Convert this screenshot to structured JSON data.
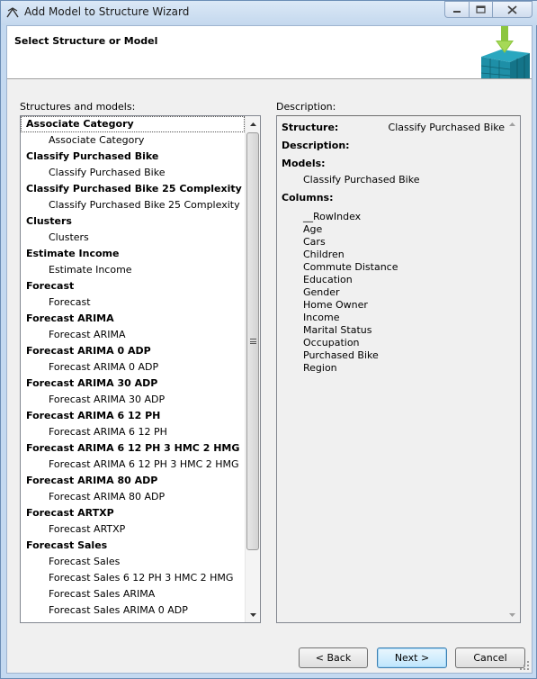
{
  "window": {
    "title": "Add Model to Structure Wizard"
  },
  "header": {
    "title": "Select Structure or Model"
  },
  "left_label": "Structures and models:",
  "right_label": "Description:",
  "list": [
    {
      "text": "Associate Category",
      "kind": "struct"
    },
    {
      "text": "Associate Category",
      "kind": "model"
    },
    {
      "text": "Classify Purchased Bike",
      "kind": "struct"
    },
    {
      "text": "Classify Purchased Bike",
      "kind": "model"
    },
    {
      "text": "Classify Purchased Bike 25 Complexity",
      "kind": "struct"
    },
    {
      "text": "Classify Purchased Bike 25 Complexity",
      "kind": "model"
    },
    {
      "text": "Clusters",
      "kind": "struct"
    },
    {
      "text": "Clusters",
      "kind": "model"
    },
    {
      "text": "Estimate Income",
      "kind": "struct"
    },
    {
      "text": "Estimate Income",
      "kind": "model"
    },
    {
      "text": "Forecast",
      "kind": "struct"
    },
    {
      "text": "Forecast",
      "kind": "model"
    },
    {
      "text": "Forecast ARIMA",
      "kind": "struct"
    },
    {
      "text": "Forecast ARIMA",
      "kind": "model"
    },
    {
      "text": "Forecast ARIMA 0 ADP",
      "kind": "struct"
    },
    {
      "text": "Forecast ARIMA 0 ADP",
      "kind": "model"
    },
    {
      "text": "Forecast ARIMA 30 ADP",
      "kind": "struct"
    },
    {
      "text": "Forecast ARIMA 30 ADP",
      "kind": "model"
    },
    {
      "text": "Forecast ARIMA 6 12 PH",
      "kind": "struct"
    },
    {
      "text": "Forecast ARIMA 6 12 PH",
      "kind": "model"
    },
    {
      "text": "Forecast ARIMA 6 12 PH 3 HMC 2 HMG",
      "kind": "struct"
    },
    {
      "text": "Forecast ARIMA 6 12 PH 3 HMC 2 HMG",
      "kind": "model"
    },
    {
      "text": "Forecast ARIMA 80 ADP",
      "kind": "struct"
    },
    {
      "text": "Forecast ARIMA 80 ADP",
      "kind": "model"
    },
    {
      "text": "Forecast ARTXP",
      "kind": "struct"
    },
    {
      "text": "Forecast ARTXP",
      "kind": "model"
    },
    {
      "text": "Forecast Sales",
      "kind": "struct"
    },
    {
      "text": "Forecast Sales",
      "kind": "model"
    },
    {
      "text": "Forecast Sales 6 12 PH 3 HMC 2 HMG",
      "kind": "model"
    },
    {
      "text": "Forecast Sales ARIMA",
      "kind": "model"
    },
    {
      "text": "Forecast Sales ARIMA 0 ADP",
      "kind": "model"
    }
  ],
  "description": {
    "structure_label": "Structure:",
    "structure_value": "Classify Purchased Bike",
    "description_label": "Description:",
    "models_label": "Models:",
    "models": [
      "Classify Purchased Bike"
    ],
    "columns_label": "Columns:",
    "columns": [
      "__RowIndex",
      "Age",
      "Cars",
      "Children",
      "Commute Distance",
      "Education",
      "Gender",
      "Home Owner",
      "Income",
      "Marital Status",
      "Occupation",
      "Purchased Bike",
      "Region"
    ]
  },
  "buttons": {
    "back": "< Back",
    "next": "Next >",
    "cancel": "Cancel"
  },
  "icons": {
    "app": "wizard-pick-icon",
    "minimize": "minimize-icon",
    "maximize": "maximize-icon",
    "close": "close-icon",
    "header": "add-to-cube-icon"
  },
  "colors": {
    "accent_green": "#8cc63f",
    "cube_teal": "#1e8fa7",
    "default_button": "#3c7fb1"
  }
}
